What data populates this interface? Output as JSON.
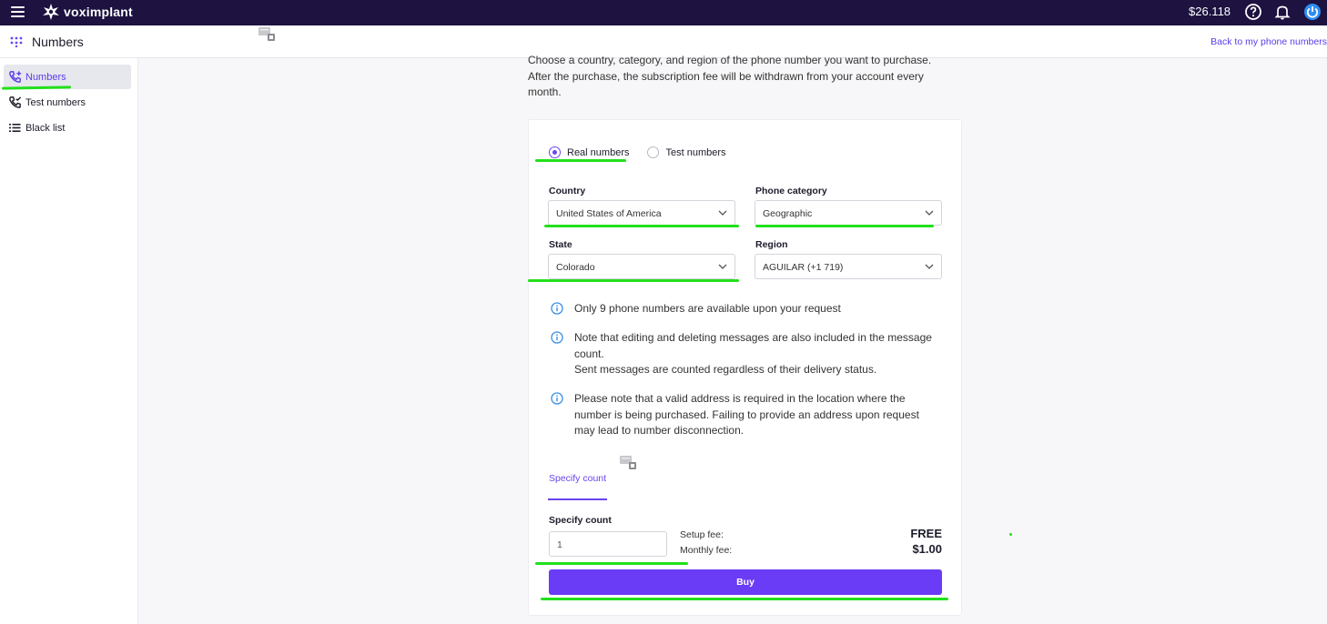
{
  "header": {
    "brand": "voximplant",
    "balance": "$26.118",
    "icons": [
      "menu-icon",
      "help-icon",
      "bell-icon",
      "power-icon"
    ]
  },
  "subheader": {
    "title": "Numbers",
    "back_link": "Back to my phone numbers"
  },
  "sidebar": {
    "items": [
      {
        "label": "Numbers",
        "icon": "phone-add-icon",
        "active": true
      },
      {
        "label": "Test numbers",
        "icon": "phone-check-icon",
        "active": false
      },
      {
        "label": "Black list",
        "icon": "list-icon",
        "active": false
      }
    ]
  },
  "intro": {
    "line1": "Choose a country, category, and region of the phone number you want to purchase.",
    "line2": "After the purchase, the subscription fee will be withdrawn from your account every month."
  },
  "form": {
    "radios": [
      {
        "label": "Real numbers",
        "selected": true
      },
      {
        "label": "Test numbers",
        "selected": false
      }
    ],
    "country": {
      "label": "Country",
      "value": "United States of America"
    },
    "category": {
      "label": "Phone category",
      "value": "Geographic"
    },
    "state": {
      "label": "State",
      "value": "Colorado"
    },
    "region": {
      "label": "Region",
      "value": "AGUILAR (+1 719)"
    },
    "notes": [
      {
        "text": "Only 9 phone numbers are available upon your request"
      },
      {
        "text": "Note that editing and deleting messages are also included in the message count.",
        "text2": "Sent messages are counted regardless of their delivery status."
      },
      {
        "text": "Please note that a valid address is required in the location where the number is being purchased. Failing to provide an address upon request may lead to number disconnection."
      }
    ],
    "tab": "Specify count",
    "count_label": "Specify count",
    "count_value": "1",
    "setup_fee_label": "Setup fee:",
    "setup_fee_value": "FREE",
    "monthly_fee_label": "Monthly fee:",
    "monthly_fee_value": "$1.00",
    "buy_label": "Buy"
  },
  "colors": {
    "topbar": "#1d1240",
    "accent": "#6a3cf5",
    "highlight": "#22e01c"
  }
}
